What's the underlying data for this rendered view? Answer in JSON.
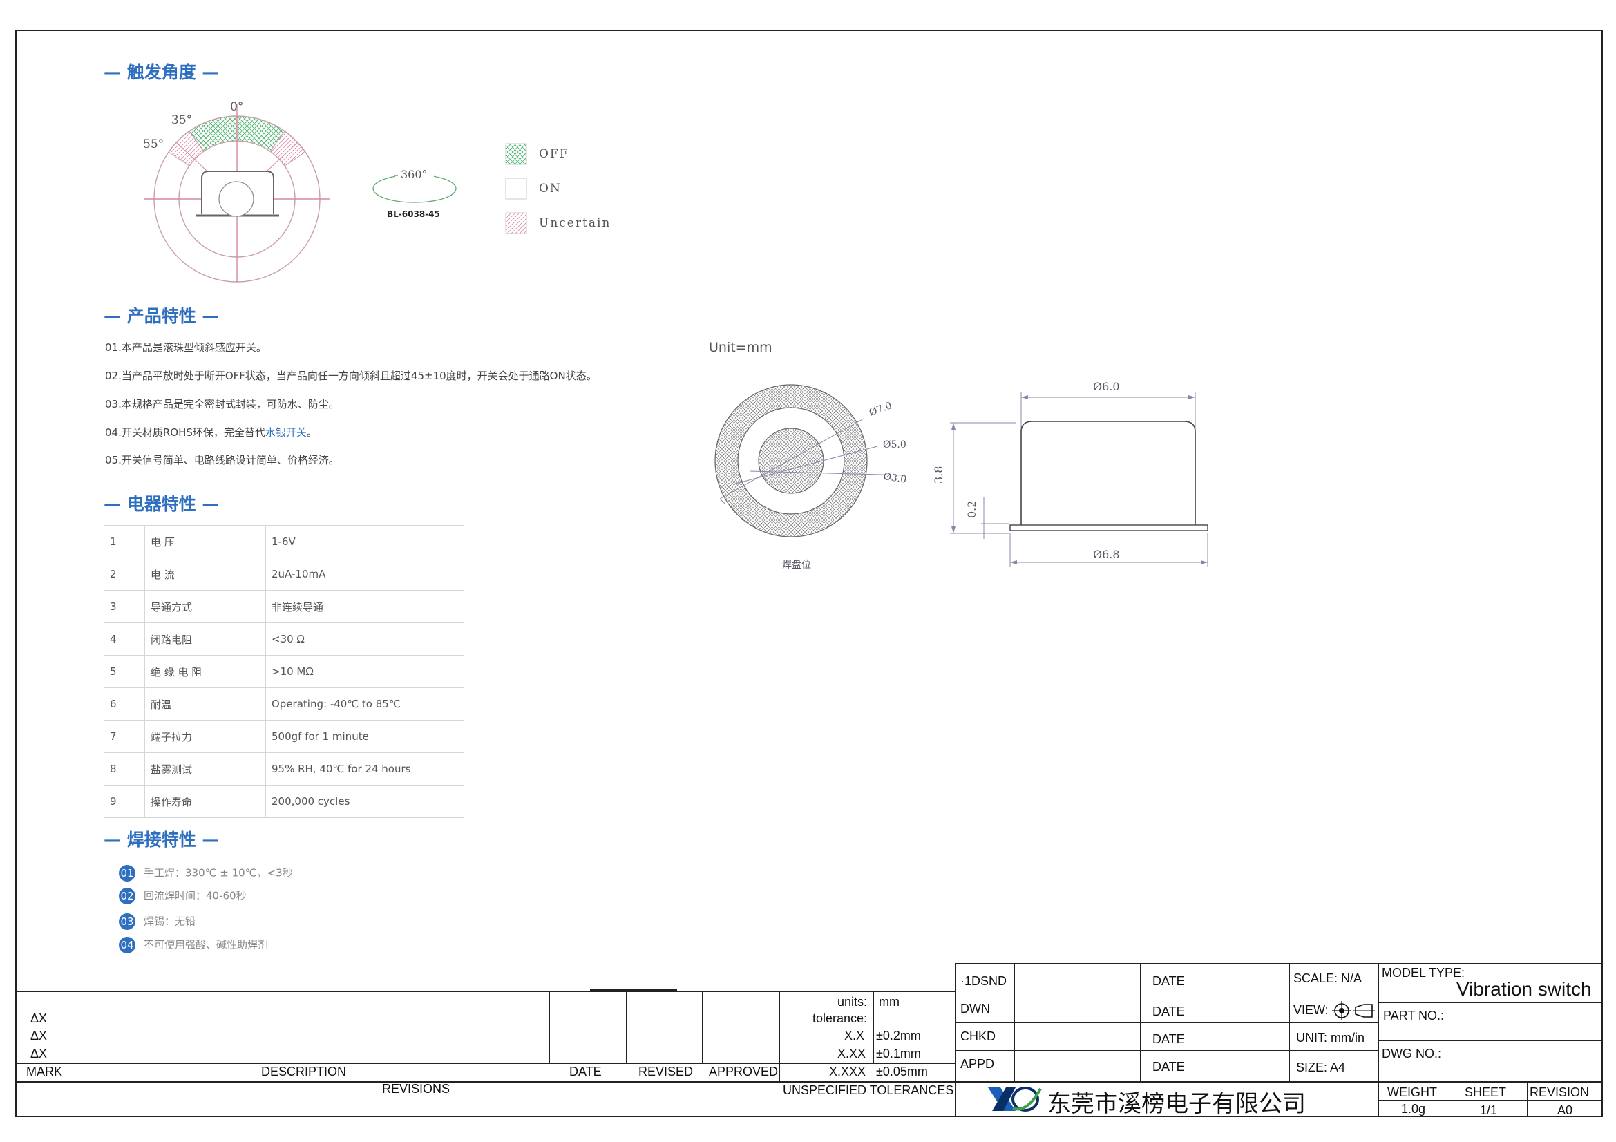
{
  "sections": {
    "trigger_angle": "— 触发角度 —",
    "features": "— 产品特性 —",
    "electrical": "— 电器特性 —",
    "welding": "— 焊接特性 —"
  },
  "angle_diagram": {
    "labels": [
      "0°",
      "35°",
      "55°"
    ],
    "spin_label": "360°",
    "model_label": "BL-6038-45",
    "legend": [
      {
        "label": "OFF",
        "pattern": "crosshatch",
        "color": "#4caf6e"
      },
      {
        "label": "ON",
        "pattern": "none",
        "color": "#d0d0d0"
      },
      {
        "label": "Uncertain",
        "pattern": "diagonal",
        "color": "#d98ca8"
      }
    ]
  },
  "features": [
    {
      "text": "01.本产品是滚珠型倾斜感应开关。"
    },
    {
      "text": "02.当产品平放时处于断开OFF状态，当产品向任一方向倾斜且超过45±10度时，开关会处于通路ON状态。"
    },
    {
      "text": "03.本规格产品是完全密封式封装，可防水、防尘。"
    },
    {
      "text_before": "04.开关材质ROHS环保，完全替代",
      "highlight": "水银开关",
      "text_after": "。"
    },
    {
      "text": "05.开关信号简单、电路线路设计简单、价格经济。"
    }
  ],
  "electrical": [
    {
      "no": "1",
      "name": "电 压",
      "value": "1-6V"
    },
    {
      "no": "2",
      "name": "电 流",
      "value": "2uA-10mA"
    },
    {
      "no": "3",
      "name": "导通方式",
      "value": "非连续导通"
    },
    {
      "no": "4",
      "name": "闭路电阻",
      "value": "<30 Ω"
    },
    {
      "no": "5",
      "name": "绝 缘 电 阻",
      "value": ">10 MΩ"
    },
    {
      "no": "6",
      "name": "耐温",
      "value": "Operating: -40℃ to 85℃"
    },
    {
      "no": "7",
      "name": "端子拉力",
      "value": "500gf for 1 minute"
    },
    {
      "no": "8",
      "name": "盐雾测试",
      "value": "95% RH, 40℃ for 24 hours"
    },
    {
      "no": "9",
      "name": "操作寿命",
      "value": "200,000 cycles"
    }
  ],
  "welding": [
    {
      "no": "01",
      "text": "手工焊：330℃ ± 10℃，<3秒"
    },
    {
      "no": "02",
      "text": "回流焊时间：40-60秒"
    },
    {
      "no": "03",
      "text": "焊锡：无铅"
    },
    {
      "no": "04",
      "text": "不可使用强酸、碱性助焊剂"
    }
  ],
  "drawing": {
    "unit": "Unit=mm",
    "pad_label": "焊盘位",
    "dims": {
      "d_outer": "Ø7.0",
      "d_mid": "Ø5.0",
      "d_inner": "Ø3.0",
      "top_width": "Ø6.0",
      "base_width": "Ø6.8",
      "height": "3.8",
      "base_height": "0.2"
    }
  },
  "title_block": {
    "revision_marks": [
      "ΔX",
      "ΔX",
      "ΔX"
    ],
    "headers": {
      "mark": "MARK",
      "description": "DESCRIPTION",
      "date": "DATE",
      "revised": "REVISED",
      "approved": "APPROVED",
      "revisions": "REVISIONS"
    },
    "tolerances": {
      "units_label": "units:",
      "units_value": "mm",
      "tolerance_label": "tolerance:",
      "x1": "X.X",
      "x1v": "±0.2mm",
      "x2": "X.XX",
      "x2v": "±0.1mm",
      "x3": "X.XXX",
      "x3v": "±0.05mm",
      "footer": "UNSPECIFIED TOLERANCES"
    },
    "sign": {
      "dsnd": "·1DSND",
      "dwn": "DWN",
      "chkd": "CHKD",
      "appd": "APPD",
      "date": "DATE"
    },
    "info": {
      "scale": "SCALE: N/A",
      "view": "VIEW:",
      "unit": "UNIT: mm/in",
      "size": "SIZE: A4"
    },
    "model": {
      "model_type_label": "MODEL TYPE:",
      "model_type_value": "Vibration switch",
      "part_no": "PART NO.:",
      "dwg_no": "DWG NO.:",
      "weight_label": "WEIGHT",
      "weight_value": "1.0g",
      "sheet_label": "SHEET",
      "sheet_value": "1/1",
      "revision_label": "REVISION",
      "revision_value": "A0"
    },
    "company": "东莞市溪榜电子有限公司"
  }
}
